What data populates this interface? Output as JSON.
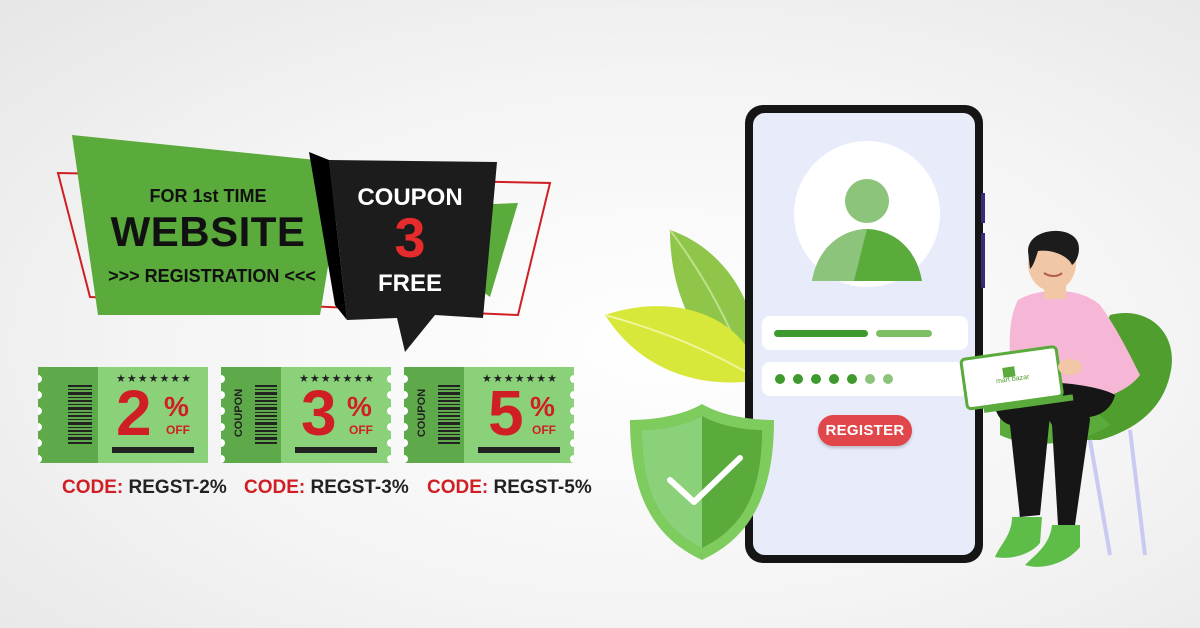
{
  "banner": {
    "line1": "FOR 1st TIME",
    "line2": "WEBSITE",
    "line3": ">>> REGISTRATION <<<"
  },
  "coupon_badge": {
    "line1": "COUPON",
    "number": "3",
    "line3": "FREE"
  },
  "tickets": [
    {
      "value": "2",
      "percent": "%",
      "off": "OFF",
      "stars": "★★★★★★★",
      "side_label": "",
      "code_label": "CODE:",
      "code_value": "REGST-2%"
    },
    {
      "value": "3",
      "percent": "%",
      "off": "OFF",
      "stars": "★★★★★★★",
      "side_label": "COUPON",
      "code_label": "CODE:",
      "code_value": "REGST-3%"
    },
    {
      "value": "5",
      "percent": "%",
      "off": "OFF",
      "stars": "★★★★★★★",
      "side_label": "COUPON",
      "code_label": "CODE:",
      "code_value": "REGST-5%"
    }
  ],
  "phone": {
    "register_label": "REGISTER"
  },
  "laptop": {
    "brand_text": "mart bazar"
  },
  "colors": {
    "brand_green": "#5aaa3c",
    "ticket_green": "#8bd17a",
    "accent_red": "#d01f24",
    "register_red": "#e0464a",
    "shirt_pink": "#f6b6d6"
  },
  "icons": [
    "user-avatar-icon",
    "shield-check-icon",
    "barcode-icon",
    "star-icon"
  ]
}
